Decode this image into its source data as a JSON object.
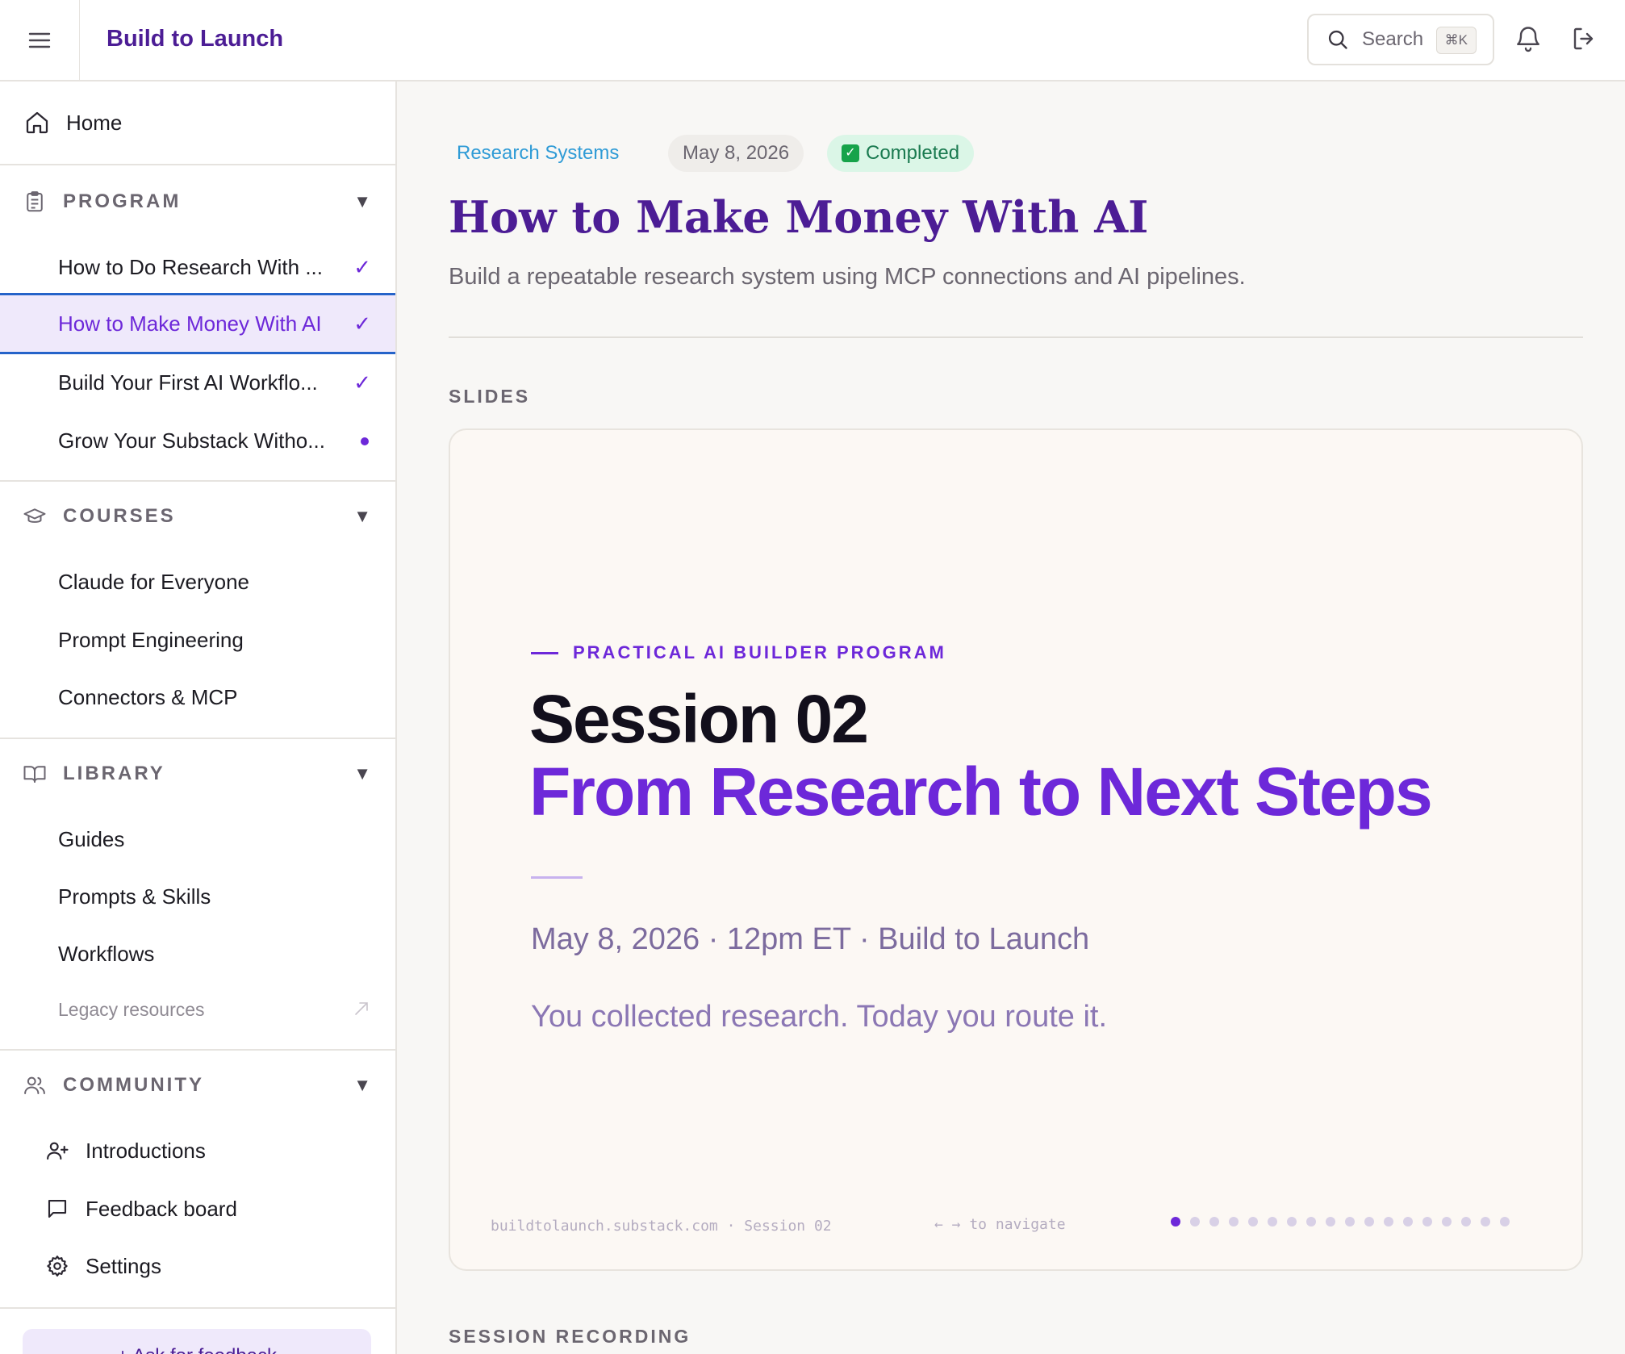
{
  "header": {
    "brand": "Build to Launch",
    "search_label": "Search",
    "search_shortcut": "⌘K"
  },
  "sidebar": {
    "home": "Home",
    "sections": [
      {
        "label": "PROGRAM",
        "items": [
          {
            "label": "How to Do Research With ...",
            "state": "done"
          },
          {
            "label": "How to Make Money With AI",
            "state": "done"
          },
          {
            "label": "Build Your First AI Workflo...",
            "state": "done"
          },
          {
            "label": "Grow Your Substack Witho...",
            "state": "in-progress"
          }
        ]
      },
      {
        "label": "COURSES",
        "items": [
          {
            "label": "Claude for Everyone"
          },
          {
            "label": "Prompt Engineering"
          },
          {
            "label": "Connectors & MCP"
          }
        ]
      },
      {
        "label": "LIBRARY",
        "items": [
          {
            "label": "Guides"
          },
          {
            "label": "Prompts & Skills"
          },
          {
            "label": "Workflows"
          },
          {
            "label": "Legacy resources"
          }
        ]
      },
      {
        "label": "COMMUNITY",
        "items": [
          {
            "label": "Introductions"
          },
          {
            "label": "Feedback board"
          },
          {
            "label": "Settings"
          }
        ]
      }
    ],
    "checkmark": "✓",
    "feedback_button": "+ Ask for feedback"
  },
  "main": {
    "category": "Research Systems",
    "date": "May 8, 2026",
    "status": "Completed",
    "title": "How to Make Money With AI",
    "subtitle": "Build a repeatable research system using MCP connections and AI pipelines.",
    "slides_heading": "SLIDES",
    "recording_heading": "SESSION RECORDING",
    "slide": {
      "eyebrow": "PRACTICAL AI BUILDER PROGRAM",
      "title": "Session 02",
      "subtitle": "From Research to Next Steps",
      "meta": "May 8, 2026 · 12pm ET · Build to Launch",
      "tagline": "You collected research. Today you route it.",
      "footer": "buildtolaunch.substack.com · Session 02",
      "nav_hint": "← → to navigate",
      "total_slides": 18,
      "current_slide": 1
    }
  },
  "colors": {
    "brand": "#4c1d95",
    "accent": "#6d28d9",
    "active_border": "#2563c9",
    "status_green": "#1a7a50",
    "category_blue": "#2f9bd6"
  }
}
